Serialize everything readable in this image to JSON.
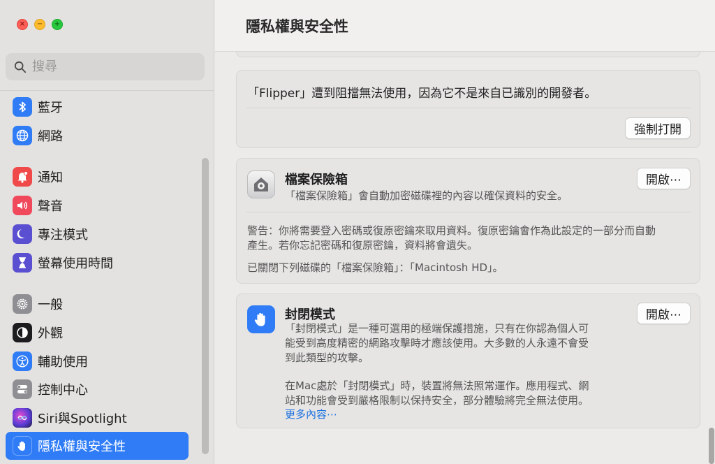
{
  "window": {
    "title": "隱私權與安全性"
  },
  "search": {
    "placeholder": "搜尋"
  },
  "sidebar": {
    "items": [
      {
        "label": "藍牙",
        "icon": "bluetooth-icon"
      },
      {
        "label": "網路",
        "icon": "globe-icon"
      },
      {
        "label": "通知",
        "icon": "bell-icon"
      },
      {
        "label": "聲音",
        "icon": "speaker-icon"
      },
      {
        "label": "專注模式",
        "icon": "moon-icon"
      },
      {
        "label": "螢幕使用時間",
        "icon": "hourglass-icon"
      },
      {
        "label": "一般",
        "icon": "gear-icon"
      },
      {
        "label": "外觀",
        "icon": "appearance-icon"
      },
      {
        "label": "輔助使用",
        "icon": "accessibility-icon"
      },
      {
        "label": "控制中心",
        "icon": "toggles-icon"
      },
      {
        "label": "Siri與Spotlight",
        "icon": "siri-icon"
      },
      {
        "label": "隱私權與安全性",
        "icon": "hand-icon"
      }
    ],
    "active_index": 11
  },
  "flipper": {
    "message": "「Flipper」遭到阻擋無法使用，因為它不是來自已識別的開發者。",
    "button": "強制打開"
  },
  "filevault": {
    "title": "檔案保險箱",
    "description": "「檔案保險箱」會自動加密磁碟裡的內容以確保資料的安全。",
    "button": "開啟⋯",
    "warning_line1": "警告：你將需要登入密碼或復原密鑰來取用資料。復原密鑰會作為此設定的一部分而自動",
    "warning_line2": "產生。若你忘記密碼和復原密鑰，資料將會遺失。",
    "status": "已關閉下列磁碟的「檔案保險箱」：「Macintosh HD」。"
  },
  "lockdown": {
    "title": "封閉模式",
    "button": "開啟⋯",
    "desc_line1": "「封閉模式」是一種可選用的極端保護措施，只有在你認為個人可",
    "desc_line2": "能受到高度精密的網路攻擊時才應該使用。大多數的人永遠不會受",
    "desc_line3": "到此類型的攻擊。",
    "mac_line1": "在Mac處於「封閉模式」時，裝置將無法照常運作。應用程式、網",
    "mac_line2": "站和功能會受到嚴格限制以保持安全，部分體驗將完全無法使用。",
    "more_link": "更多內容⋯"
  },
  "colors": {
    "accent": "#2f7cf6",
    "link": "#1a6fe0"
  }
}
